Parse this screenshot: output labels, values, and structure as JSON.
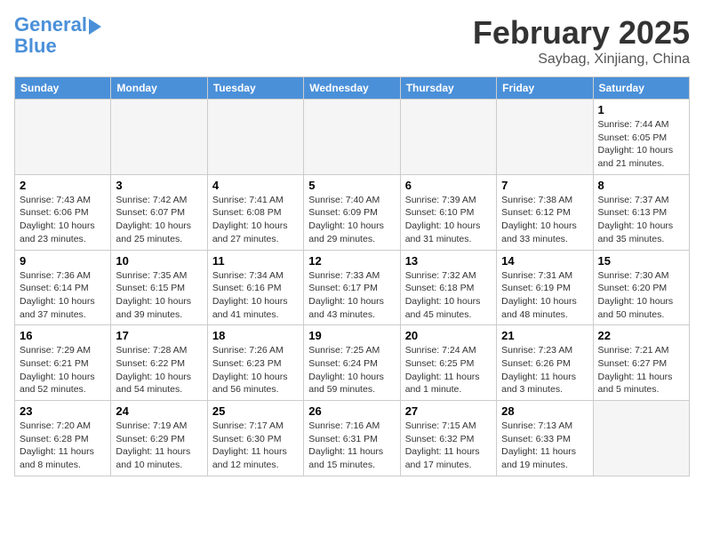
{
  "logo": {
    "line1": "General",
    "line2": "Blue"
  },
  "header": {
    "month": "February 2025",
    "location": "Saybag, Xinjiang, China"
  },
  "weekdays": [
    "Sunday",
    "Monday",
    "Tuesday",
    "Wednesday",
    "Thursday",
    "Friday",
    "Saturday"
  ],
  "weeks": [
    [
      {
        "day": "",
        "info": ""
      },
      {
        "day": "",
        "info": ""
      },
      {
        "day": "",
        "info": ""
      },
      {
        "day": "",
        "info": ""
      },
      {
        "day": "",
        "info": ""
      },
      {
        "day": "",
        "info": ""
      },
      {
        "day": "1",
        "info": "Sunrise: 7:44 AM\nSunset: 6:05 PM\nDaylight: 10 hours and 21 minutes."
      }
    ],
    [
      {
        "day": "2",
        "info": "Sunrise: 7:43 AM\nSunset: 6:06 PM\nDaylight: 10 hours and 23 minutes."
      },
      {
        "day": "3",
        "info": "Sunrise: 7:42 AM\nSunset: 6:07 PM\nDaylight: 10 hours and 25 minutes."
      },
      {
        "day": "4",
        "info": "Sunrise: 7:41 AM\nSunset: 6:08 PM\nDaylight: 10 hours and 27 minutes."
      },
      {
        "day": "5",
        "info": "Sunrise: 7:40 AM\nSunset: 6:09 PM\nDaylight: 10 hours and 29 minutes."
      },
      {
        "day": "6",
        "info": "Sunrise: 7:39 AM\nSunset: 6:10 PM\nDaylight: 10 hours and 31 minutes."
      },
      {
        "day": "7",
        "info": "Sunrise: 7:38 AM\nSunset: 6:12 PM\nDaylight: 10 hours and 33 minutes."
      },
      {
        "day": "8",
        "info": "Sunrise: 7:37 AM\nSunset: 6:13 PM\nDaylight: 10 hours and 35 minutes."
      }
    ],
    [
      {
        "day": "9",
        "info": "Sunrise: 7:36 AM\nSunset: 6:14 PM\nDaylight: 10 hours and 37 minutes."
      },
      {
        "day": "10",
        "info": "Sunrise: 7:35 AM\nSunset: 6:15 PM\nDaylight: 10 hours and 39 minutes."
      },
      {
        "day": "11",
        "info": "Sunrise: 7:34 AM\nSunset: 6:16 PM\nDaylight: 10 hours and 41 minutes."
      },
      {
        "day": "12",
        "info": "Sunrise: 7:33 AM\nSunset: 6:17 PM\nDaylight: 10 hours and 43 minutes."
      },
      {
        "day": "13",
        "info": "Sunrise: 7:32 AM\nSunset: 6:18 PM\nDaylight: 10 hours and 45 minutes."
      },
      {
        "day": "14",
        "info": "Sunrise: 7:31 AM\nSunset: 6:19 PM\nDaylight: 10 hours and 48 minutes."
      },
      {
        "day": "15",
        "info": "Sunrise: 7:30 AM\nSunset: 6:20 PM\nDaylight: 10 hours and 50 minutes."
      }
    ],
    [
      {
        "day": "16",
        "info": "Sunrise: 7:29 AM\nSunset: 6:21 PM\nDaylight: 10 hours and 52 minutes."
      },
      {
        "day": "17",
        "info": "Sunrise: 7:28 AM\nSunset: 6:22 PM\nDaylight: 10 hours and 54 minutes."
      },
      {
        "day": "18",
        "info": "Sunrise: 7:26 AM\nSunset: 6:23 PM\nDaylight: 10 hours and 56 minutes."
      },
      {
        "day": "19",
        "info": "Sunrise: 7:25 AM\nSunset: 6:24 PM\nDaylight: 10 hours and 59 minutes."
      },
      {
        "day": "20",
        "info": "Sunrise: 7:24 AM\nSunset: 6:25 PM\nDaylight: 11 hours and 1 minute."
      },
      {
        "day": "21",
        "info": "Sunrise: 7:23 AM\nSunset: 6:26 PM\nDaylight: 11 hours and 3 minutes."
      },
      {
        "day": "22",
        "info": "Sunrise: 7:21 AM\nSunset: 6:27 PM\nDaylight: 11 hours and 5 minutes."
      }
    ],
    [
      {
        "day": "23",
        "info": "Sunrise: 7:20 AM\nSunset: 6:28 PM\nDaylight: 11 hours and 8 minutes."
      },
      {
        "day": "24",
        "info": "Sunrise: 7:19 AM\nSunset: 6:29 PM\nDaylight: 11 hours and 10 minutes."
      },
      {
        "day": "25",
        "info": "Sunrise: 7:17 AM\nSunset: 6:30 PM\nDaylight: 11 hours and 12 minutes."
      },
      {
        "day": "26",
        "info": "Sunrise: 7:16 AM\nSunset: 6:31 PM\nDaylight: 11 hours and 15 minutes."
      },
      {
        "day": "27",
        "info": "Sunrise: 7:15 AM\nSunset: 6:32 PM\nDaylight: 11 hours and 17 minutes."
      },
      {
        "day": "28",
        "info": "Sunrise: 7:13 AM\nSunset: 6:33 PM\nDaylight: 11 hours and 19 minutes."
      },
      {
        "day": "",
        "info": ""
      }
    ]
  ]
}
